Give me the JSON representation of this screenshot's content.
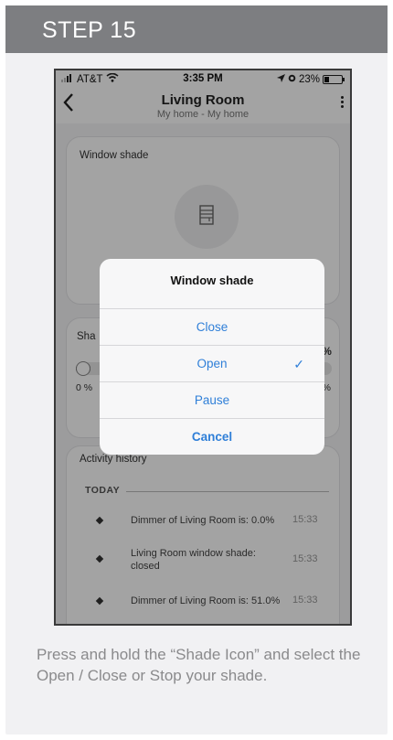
{
  "header": {
    "step": "STEP 15"
  },
  "statusbar": {
    "carrier": "AT&T",
    "time": "3:35 PM",
    "battery": "23%"
  },
  "app": {
    "title": "Living Room",
    "subtitle": "My home - My home",
    "back_icon": "chevron-left-icon",
    "menu_icon": "kebab-icon"
  },
  "shade_panel": {
    "label": "Window shade"
  },
  "slider_panel": {
    "label": "Sha",
    "level_pct": "0 %",
    "min_label": "0 %",
    "max_label": "00 %",
    "level": 0.0
  },
  "history": {
    "title": "Activity history",
    "section": "TODAY",
    "items": [
      {
        "text": "Dimmer of Living Room is: 0.0%",
        "time": "15:33"
      },
      {
        "text": "Living Room window shade: closed",
        "time": "15:33"
      },
      {
        "text": "Dimmer of Living Room is: 51.0%",
        "time": "15:33"
      }
    ]
  },
  "dialog": {
    "title": "Window shade",
    "options": [
      {
        "label": "Close",
        "selected": false
      },
      {
        "label": "Open",
        "selected": true
      },
      {
        "label": "Pause",
        "selected": false
      }
    ],
    "cancel": "Cancel",
    "check": "✓"
  },
  "caption": "Press and hold the “Shade Icon” and select  the Open / Close or Stop your shade.",
  "colors": {
    "accent": "#2f7fd8",
    "header_bg": "#7d7e81",
    "card_bg": "#f1f1f3",
    "caption": "#8a8a8c"
  }
}
